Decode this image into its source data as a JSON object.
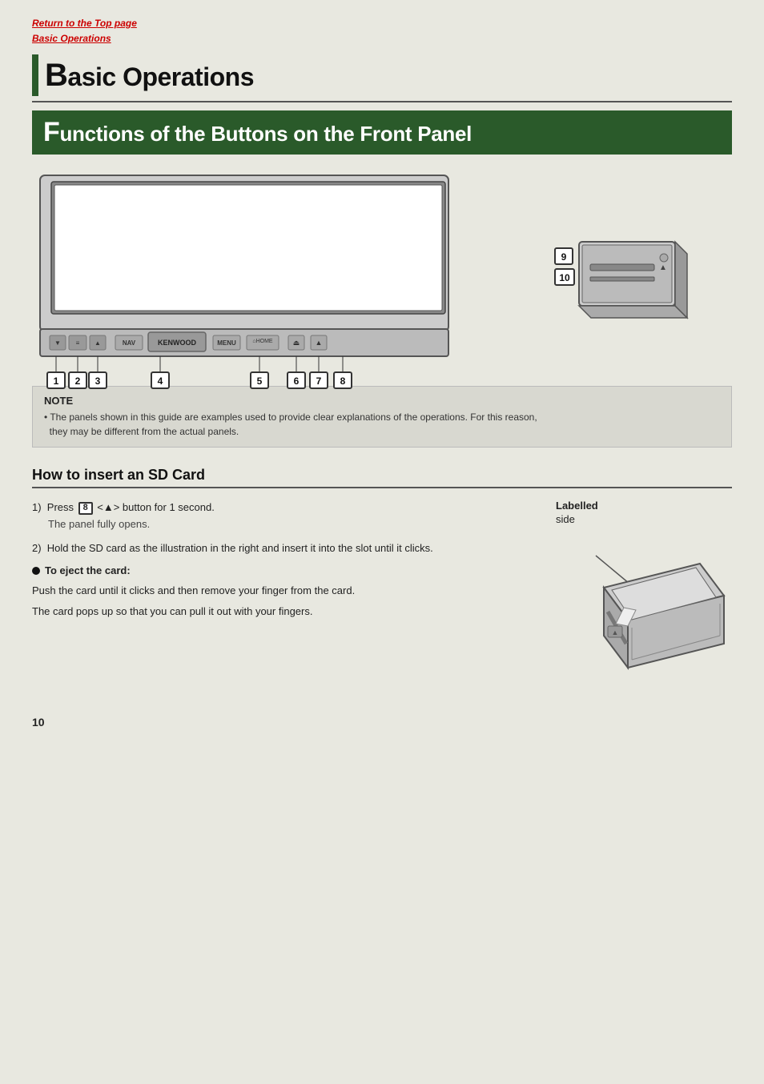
{
  "breadcrumb": {
    "return_link": "Return to the Top page",
    "current_link": "Basic Operations"
  },
  "page_title": "Basic Operations",
  "page_title_big_letter": "B",
  "page_title_rest": "asic Operations",
  "sub_title": "Functions of the Buttons on the Front Panel",
  "sub_title_big": "F",
  "sub_title_rest": "unctions of the Buttons on the Front Panel",
  "button_labels": {
    "nav": "NAV",
    "kenwood": "KENWOOD",
    "menu": "MENU",
    "home": "⌂HOME"
  },
  "number_labels": [
    "1",
    "2",
    "3",
    "4",
    "5",
    "6",
    "7",
    "8",
    "9",
    "10"
  ],
  "note": {
    "title": "NOTE",
    "text": "• The panels shown in this guide are examples used to provide clear explanations of the operations. For this reason,\n  they may be different from the actual panels."
  },
  "how_to_title": "How to insert an SD Card",
  "steps": [
    {
      "num": "1)",
      "text_before": "Press ",
      "badge": "8",
      "text_after": " <▲> button for 1 second."
    },
    {
      "sub": "The panel fully opens."
    },
    {
      "num": "2)",
      "text": "Hold the SD card as the illustration in the right and insert it into the slot until it clicks."
    }
  ],
  "eject": {
    "title": "To eject the card:",
    "desc1": "Push the card until it clicks and then remove your finger from the card.",
    "desc2": "The card pops up so that you can pull it out with your fingers."
  },
  "sd_illustration": {
    "labelled": "Labelled",
    "side": "side"
  },
  "page_number": "10"
}
